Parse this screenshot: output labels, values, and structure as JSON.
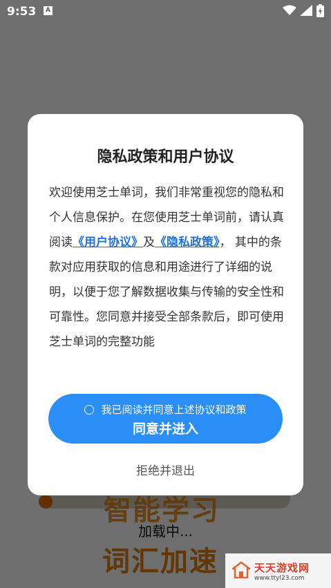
{
  "status_bar": {
    "time": "9:53",
    "notification_icon": "A"
  },
  "background": {
    "slogan_line1": "智能学习",
    "slogan_line2": "词汇加速",
    "loading_text": "加载中..."
  },
  "dialog": {
    "title": "隐私政策和用户协议",
    "body_intro": "欢迎使用芝士单词，我们非常重视您的隐私和个人信息保护。在您使用芝士单词前，请认真阅读",
    "user_agreement_link": "《用户协议》",
    "and_text": "及",
    "privacy_policy_link": "《隐私政策》",
    "body_rest": "， 其中的条款对应用获取的信息和用途进行了详细的说明，以便于您了解数据收集与传输的安全性和可靠性。您同意并接受全部条款后，即可使用芝士单词的完整功能",
    "checkbox_label": "我已阅读并同意上述协议和政策",
    "agree_button": "同意并进入",
    "reject_button": "拒绝并退出"
  },
  "watermark": {
    "name": "天天游戏网",
    "url": "www.ttyl23.com"
  },
  "colors": {
    "primary": "#2b8ef6",
    "link": "#1f72d6",
    "accent_orange": "#c46f06"
  }
}
